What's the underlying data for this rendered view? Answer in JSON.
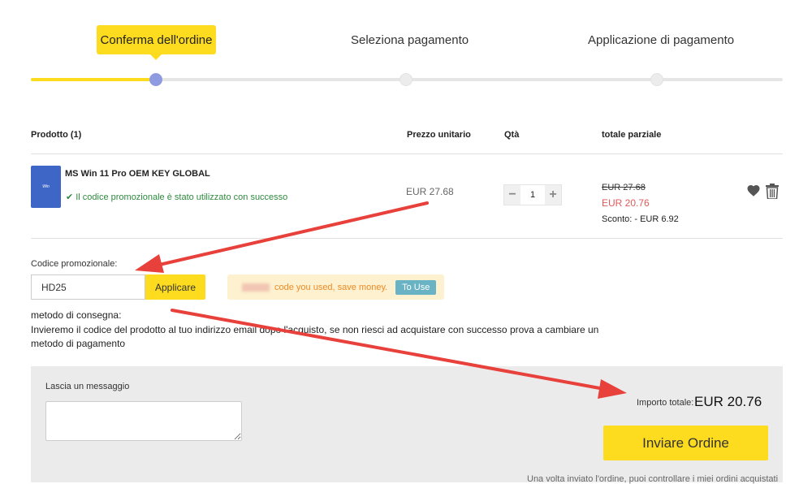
{
  "steps": {
    "current": "Conferma dell'ordine",
    "next": "Seleziona pagamento",
    "last": "Applicazione di pagamento"
  },
  "table": {
    "col_product": "Prodotto (1)",
    "col_unit_price": "Prezzo unitario",
    "col_qty": "Qtà",
    "col_subtotal": "totale parziale"
  },
  "product": {
    "thumb_text": "Win",
    "name": "MS Win 11 Pro OEM KEY GLOBAL",
    "promo_success": "Il codice promozionale è stato utilizzato con successo",
    "unit_price": "EUR 27.68",
    "qty": "1",
    "qty_minus": "−",
    "qty_plus": "+",
    "old_price": "EUR 27.68",
    "new_price": "EUR 20.76",
    "discount": "Sconto: - EUR 6.92"
  },
  "promo": {
    "label": "Codice promozionale:",
    "value": "HD25",
    "apply_label": "Applicare",
    "coupon_text": "code you used, save money.",
    "to_use_label": "To Use"
  },
  "delivery": {
    "title": "metodo di consegna:",
    "text": "Invieremo il codice del prodotto al tuo indirizzo email dopo l'acquisto, se non riesci ad acquistare con successo prova a cambiare un metodo di pagamento"
  },
  "footer": {
    "message_label": "Lascia un messaggio",
    "total_label": "Importo totale:",
    "total_value": "EUR 20.76",
    "order_button": "Inviare Ordine",
    "after_note": "Una volta inviato l'ordine, puoi controllare i miei ordini acquistati"
  },
  "colors": {
    "accent": "#fddb1f",
    "success": "#2e8a3e",
    "discount_price": "#e05a5a",
    "arrow": "#e8403a"
  }
}
